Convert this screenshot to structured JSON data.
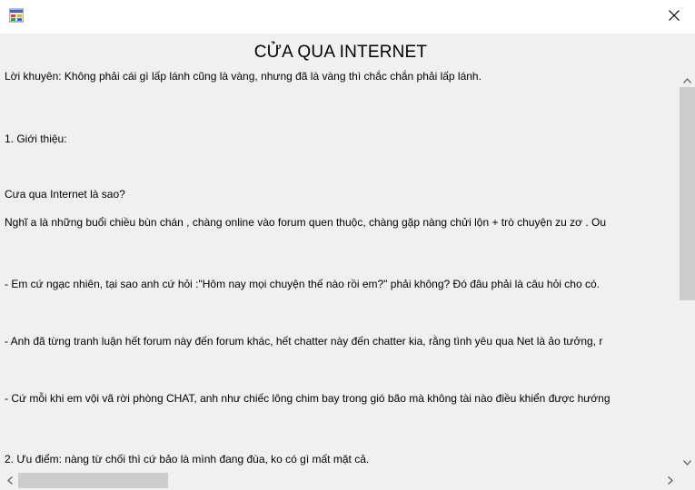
{
  "window": {
    "icon": "app-icon",
    "close_icon": "close-icon"
  },
  "document": {
    "title": "CỬA QUA INTERNET",
    "lines": [
      "Lời khuyên: Không phải cái gì lấp lánh cũng là vàng, nhưng đã là vàng thì chắc chắn phải lấp lánh.",
      "1. Giới thiệu:",
      "Cưa qua Internet là sao?",
      "Nghĩ a là những buổi chiều bùn chán , chàng online vào forum quen thuộc,  chàng gặp nàng chửi lộn + trò chuyện zu zơ . Ou",
      "- Em cứ ngạc nhiên,  tại sao anh cứ hỏi :\"Hôm nay mọi chuyện thế nào rồi em?\" phải không? Đó  đâu phải là câu hỏi cho có.",
      "- Anh đã từng tranh luận hết  forum này đến forum khác, hết chatter này đến chatter kia, rằng tình  yêu qua Net là ảo tưởng, r",
      "-  Cứ mỗi khi em vội vã rời phòng CHAT, anh như chiếc lông chim bay trong  gió bão mà không tài nào điều khiển được hướng",
      "2. Ưu điểm: nàng từ chối thì cứ bảo là mình đang đùa, ko có gì mất mặt cả."
    ]
  },
  "scrollbars": {
    "up_icon": "chevron-up-icon",
    "down_icon": "chevron-down-icon",
    "left_icon": "chevron-left-icon",
    "right_icon": "chevron-right-icon"
  }
}
